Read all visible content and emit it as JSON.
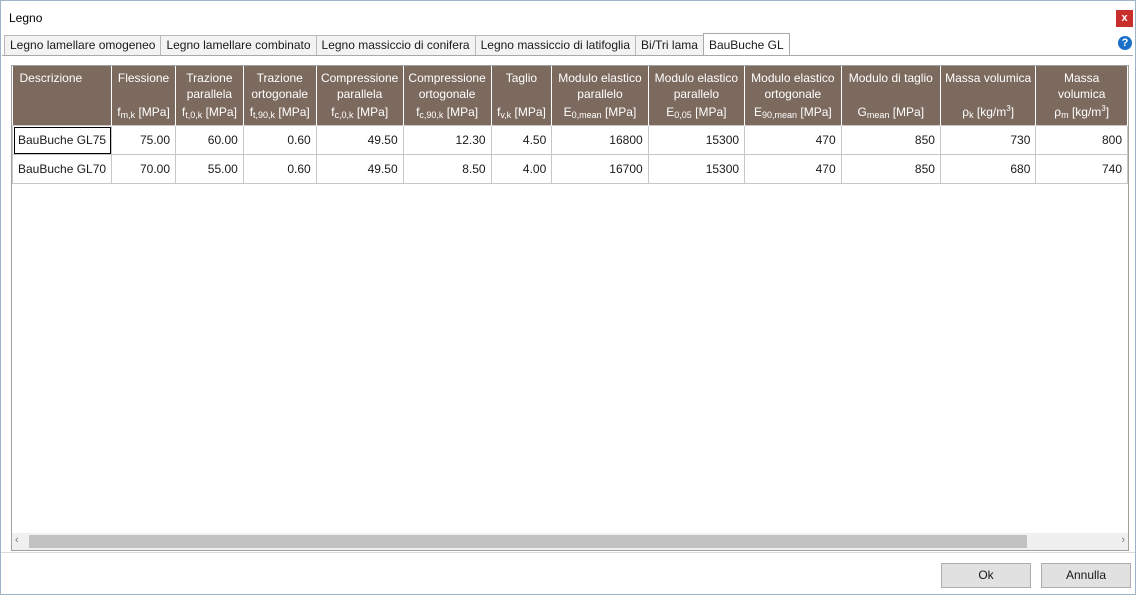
{
  "window": {
    "title": "Legno",
    "close_label": "x",
    "help_label": "?"
  },
  "tabs": [
    {
      "label": "Legno lamellare omogeneo"
    },
    {
      "label": "Legno lamellare combinato"
    },
    {
      "label": "Legno massiccio di conifera"
    },
    {
      "label": "Legno massiccio di latifoglia"
    },
    {
      "label": "Bi/Tri lama"
    },
    {
      "label": "BauBuche GL",
      "active": true
    }
  ],
  "table": {
    "columns": [
      {
        "label": "Descrizione",
        "sym": "",
        "sub": "",
        "sup": "",
        "unit": ""
      },
      {
        "label": "Flessione",
        "sym": "f",
        "sub": "m,k",
        "sup": "",
        "unit": " [MPa]"
      },
      {
        "label": "Trazione parallela",
        "sym": "f",
        "sub": "t,0,k",
        "sup": "",
        "unit": " [MPa]"
      },
      {
        "label": "Trazione ortogonale",
        "sym": "f",
        "sub": "t,90,k",
        "sup": "",
        "unit": " [MPa]"
      },
      {
        "label": "Compressione parallela",
        "sym": "f",
        "sub": "c,0,k",
        "sup": "",
        "unit": " [MPa]"
      },
      {
        "label": "Compressione ortogonale",
        "sym": "f",
        "sub": "c,90,k",
        "sup": "",
        "unit": " [MPa]"
      },
      {
        "label": "Taglio",
        "sym": "f",
        "sub": "v,k",
        "sup": "",
        "unit": " [MPa]"
      },
      {
        "label": "Modulo elastico parallelo",
        "sym": "E",
        "sub": "0,mean",
        "sup": "",
        "unit": " [MPa]"
      },
      {
        "label": "Modulo elastico parallelo",
        "sym": "E",
        "sub": "0,05",
        "sup": "",
        "unit": " [MPa]"
      },
      {
        "label": "Modulo elastico ortogonale",
        "sym": "E",
        "sub": "90,mean",
        "sup": "",
        "unit": " [MPa]"
      },
      {
        "label": "Modulo di taglio",
        "sym": "G",
        "sub": "mean",
        "sup": "",
        "unit": " [MPa]"
      },
      {
        "label": "Massa volumica",
        "sym": "ρ",
        "sub": "k",
        "sup": "3",
        "unit": " [kg/m"
      },
      {
        "label": "Massa volumica",
        "sym": "ρ",
        "sub": "m",
        "sup": "3",
        "unit": " [kg/m"
      }
    ],
    "rows": [
      [
        "BauBuche GL75",
        "75.00",
        "60.00",
        "0.60",
        "49.50",
        "12.30",
        "4.50",
        "16800",
        "15300",
        "470",
        "850",
        "730",
        "800"
      ],
      [
        "BauBuche GL70",
        "70.00",
        "55.00",
        "0.60",
        "49.50",
        "8.50",
        "4.00",
        "16700",
        "15300",
        "470",
        "850",
        "680",
        "740"
      ]
    ]
  },
  "scrollbar": {
    "left_arrow": "‹",
    "right_arrow": "›"
  },
  "buttons": {
    "ok": "Ok",
    "cancel": "Annulla"
  }
}
